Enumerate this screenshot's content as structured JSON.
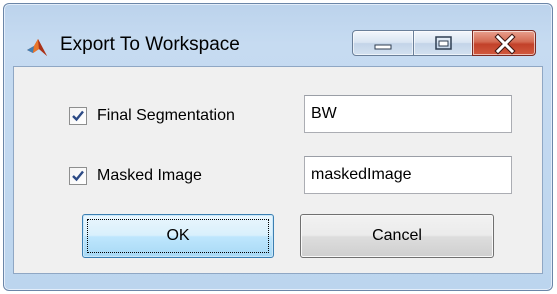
{
  "window": {
    "title": "Export To Workspace",
    "icon": "matlab-membrane-icon"
  },
  "caption_buttons": {
    "minimize_icon": "minimize-icon",
    "maximize_icon": "maximize-icon",
    "close_icon": "close-icon"
  },
  "rows": [
    {
      "label": "Final Segmentation",
      "checked": true,
      "value": "BW"
    },
    {
      "label": "Masked Image",
      "checked": true,
      "value": "maskedImage"
    }
  ],
  "buttons": {
    "ok_label": "OK",
    "cancel_label": "Cancel"
  },
  "colors": {
    "window_frame": "#bcd3ec",
    "close_button": "#c2412a",
    "ok_button_border": "#3c7fb1",
    "checkmark": "#2c4a85"
  }
}
